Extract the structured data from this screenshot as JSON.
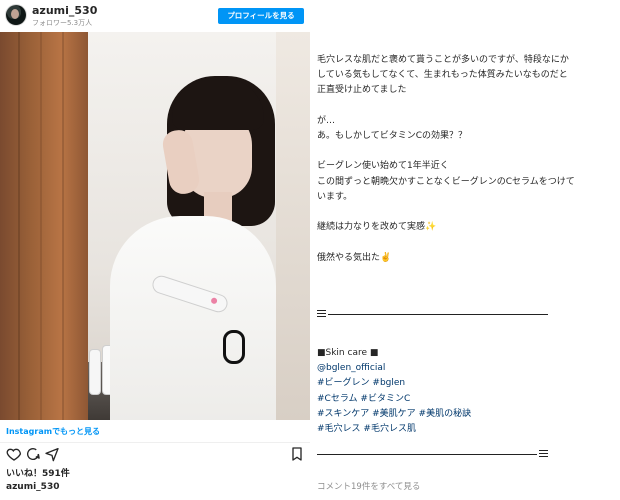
{
  "header": {
    "username": "azumi_530",
    "followers": "フォロワー5.3万人",
    "profile_button": "プロフィールを見る"
  },
  "embed": {
    "more_link": "Instagramでもっと見る",
    "likes": "いいね！591件",
    "owner": "azumi_530"
  },
  "icons": {
    "avatar": "profile-avatar",
    "like": "heart-icon",
    "comment": "comment-icon",
    "share": "share-icon",
    "save": "bookmark-icon"
  },
  "caption": {
    "lines": [
      "毛穴レスな肌だと褒めて貰うことが多いのですが、特段なにか",
      "している気もしてなくて、生まれもった体質みたいなものだと",
      "正直受け止めてました",
      "",
      "が…",
      "あ。もしかしてビタミンCの効果？？",
      "",
      "ビーグレン使い始めて1年半近く",
      "この間ずっと朝晩欠かすことなくビーグレンのCセラムをつけて",
      "います。",
      "",
      "継続は力なりを改めて実感✨",
      "",
      "俄然やる気出た✌️"
    ],
    "section_title": "■Skin care ■",
    "tag_lines": [
      "@bglen_official",
      "#ビーグレン #bglen",
      "#Cセラム #ビタミンC",
      "#スキンケア #美肌ケア #美肌の秘訣",
      "#毛穴レス #毛穴レス肌"
    ],
    "comments_link": "コメント19件をすべて見る"
  }
}
